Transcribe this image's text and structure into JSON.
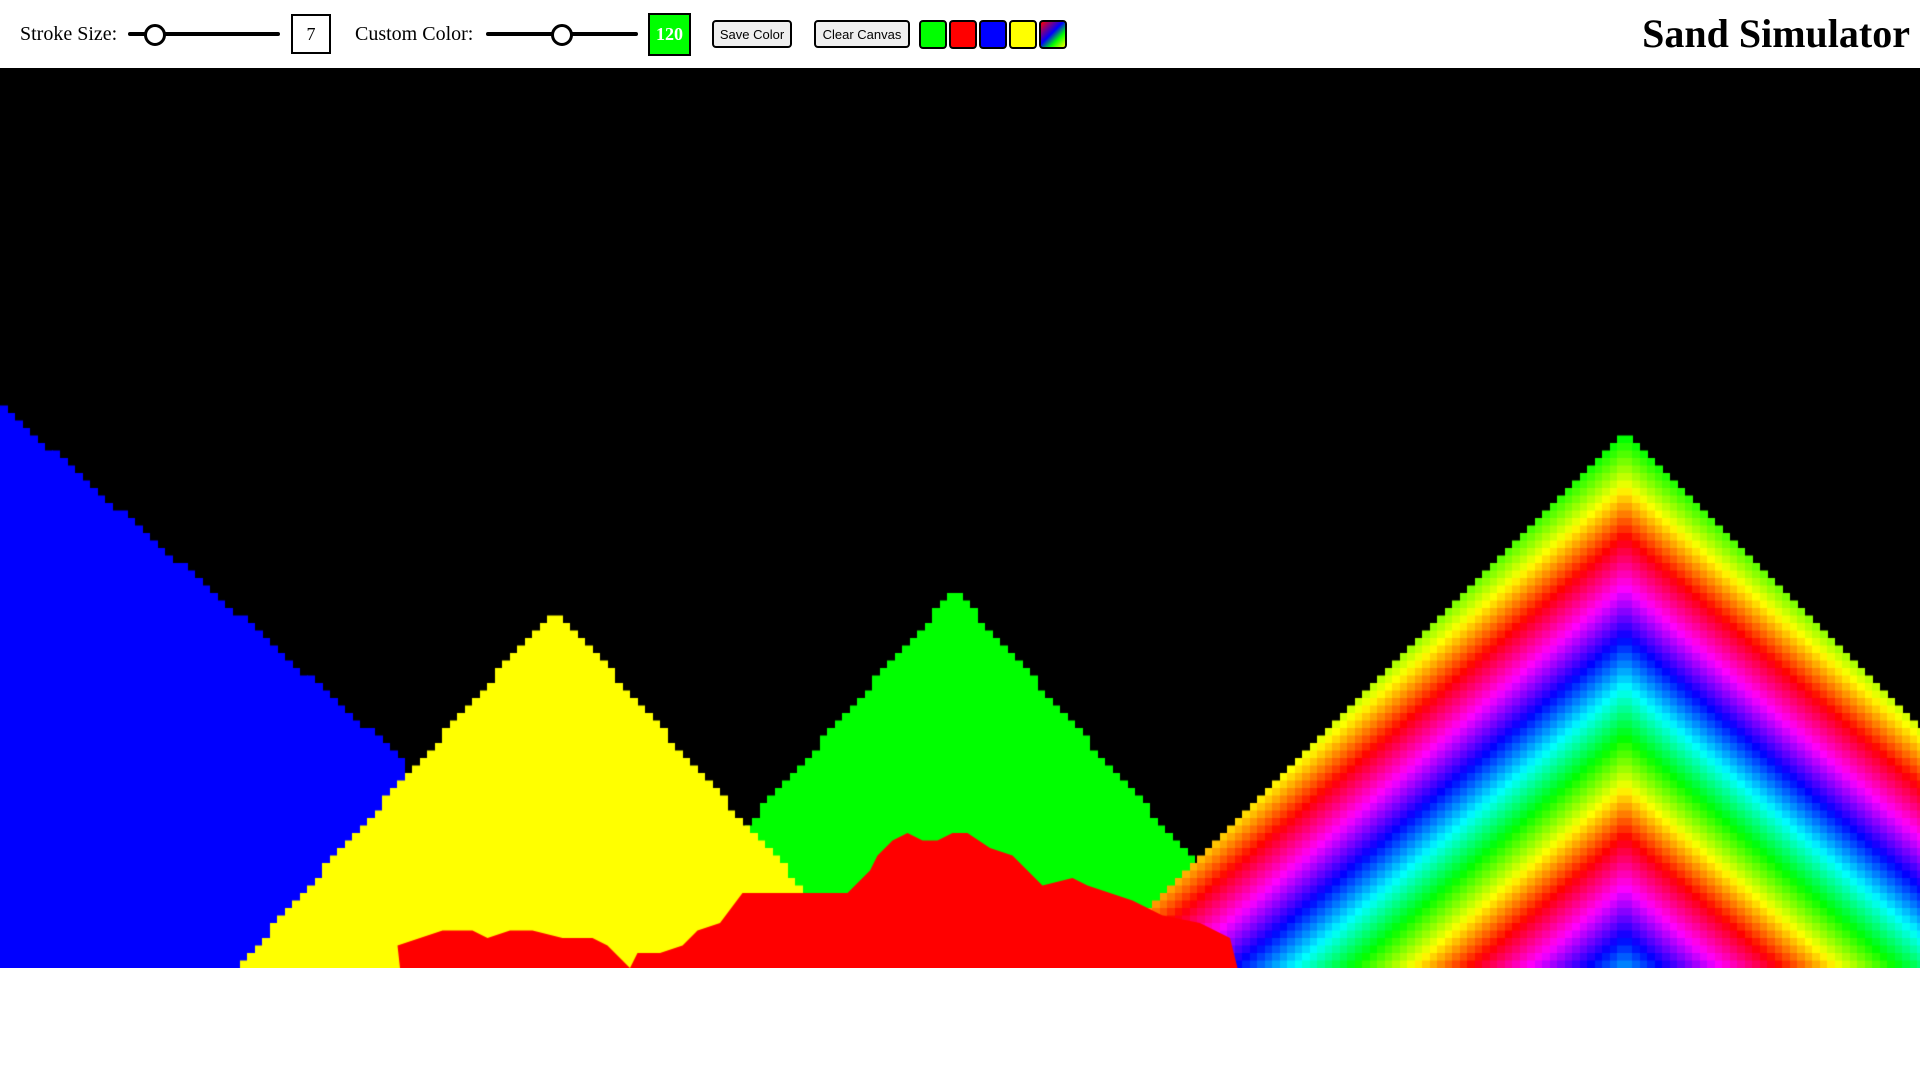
{
  "toolbar": {
    "stroke_label": "Stroke Size:",
    "stroke_value": "7",
    "stroke_slider_fraction": 0.12,
    "custom_color_label": "Custom Color:",
    "hue_value": "120",
    "hue_slider_fraction": 0.5,
    "save_color_label": "Save Color",
    "clear_canvas_label": "Clear Canvas",
    "swatches": [
      {
        "color": "#00ff00"
      },
      {
        "color": "#ff0000"
      },
      {
        "color": "#0000ff"
      },
      {
        "color": "#ffff00"
      },
      {
        "color": "rainbow"
      }
    ]
  },
  "title": "Sand Simulator",
  "canvas": {
    "background": "#000000"
  }
}
